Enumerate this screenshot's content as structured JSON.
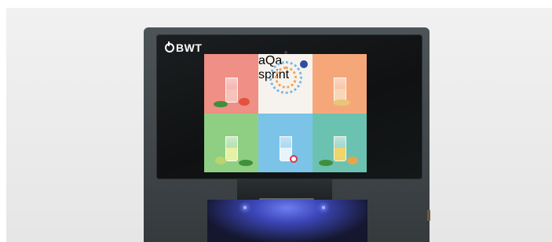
{
  "brand": {
    "name": "BWT",
    "logo_icon": "bwt-logo-icon"
  },
  "screen": {
    "tiles": [
      {
        "id": "tile-red",
        "title": "",
        "bg": "#ef8f86",
        "liquid": "#f4c3b9",
        "fruit": "#e2523f",
        "icon": "strawberry-icon"
      },
      {
        "id": "tile-logo",
        "title": "",
        "bg": "#f6f3ee",
        "label": "aQa sprint",
        "badge": "",
        "icon": "aqa-ring-icon"
      },
      {
        "id": "tile-orange",
        "title": "",
        "bg": "#f6a77a",
        "liquid": "#f8d7b8",
        "fruit": "#e9c47a",
        "icon": "ginger-icon"
      },
      {
        "id": "tile-green",
        "title": "",
        "bg": "#8fcf84",
        "liquid": "#e6f0a6",
        "fruit": "#b9d56b",
        "icon": "lime-icon"
      },
      {
        "id": "tile-blue",
        "title": "",
        "bg": "#7bc4e8",
        "liquid": "#e8f4fb",
        "icon": "still-water-icon"
      },
      {
        "id": "tile-teal",
        "title": "",
        "bg": "#6cc2b0",
        "liquid": "#efd56b",
        "fruit": "#e6a548",
        "icon": "orange-icon"
      }
    ]
  },
  "colors": {
    "machine_body": "#43494c",
    "bezel": "#131617",
    "led": "#7b95ff"
  }
}
